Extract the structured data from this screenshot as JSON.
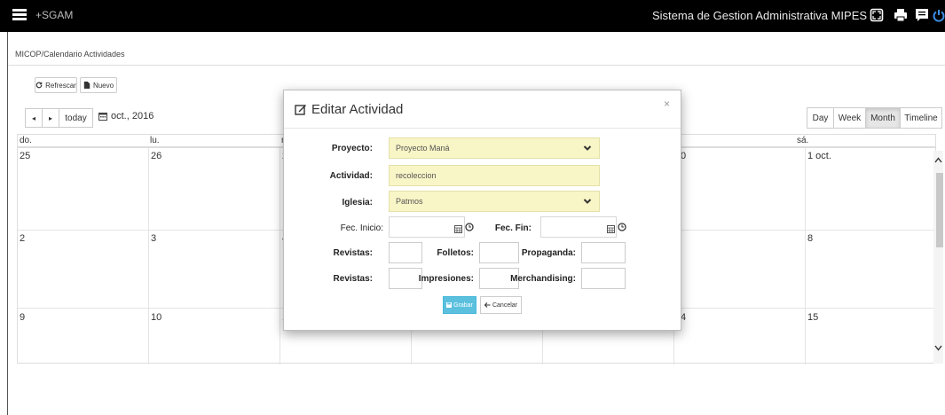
{
  "topbar": {
    "brand": "+SGAM",
    "system_title": "Sistema de Gestion Administrativa MIPES",
    "icons": [
      "menu-icon",
      "fullscreen-icon",
      "print-icon",
      "message-icon",
      "power-icon"
    ]
  },
  "breadcrumb": "MICOP/Calendario Actividades",
  "toolbar": {
    "refresh_label": "Refrescar",
    "new_label": "Nuevo"
  },
  "calendar": {
    "today_label": "today",
    "prev_symbol": "◂",
    "next_symbol": "▸",
    "title": "oct., 2016",
    "views": [
      "Day",
      "Week",
      "Month",
      "Timeline"
    ],
    "active_view": "Month",
    "day_headers": [
      "do.",
      "lu.",
      "m",
      "",
      "",
      "",
      "sá."
    ],
    "weeks": [
      [
        "25",
        "26",
        "2",
        "",
        "",
        "0",
        "1 oct."
      ],
      [
        "2",
        "3",
        "4",
        "",
        "",
        "",
        "8"
      ],
      [
        "9",
        "10",
        "1",
        "",
        "",
        "4",
        "15"
      ]
    ]
  },
  "modal": {
    "title": "Editar Actividad",
    "close_symbol": "×",
    "labels": {
      "proyecto": "Proyecto:",
      "actividad": "Actividad:",
      "iglesia": "Iglesia:",
      "fec_inicio": "Fec. Inicio:",
      "fec_fin": "Fec. Fin:",
      "revistas": "Revistas:",
      "folletos": "Folletos:",
      "propaganda": "Propaganda:",
      "revistas2": "Revistas:",
      "impresiones": "Impresiones:",
      "merchandising": "Merchandising:"
    },
    "values": {
      "proyecto": "Proyecto Maná",
      "actividad": "recoleccion",
      "iglesia": "Patmos",
      "fec_inicio": "",
      "fec_fin": ""
    },
    "save_label": "Grabar",
    "cancel_label": "Cancelar"
  },
  "colors": {
    "topbar": "#000000",
    "yellow_field": "#f8f5c6",
    "primary_button": "#5bc0de"
  }
}
